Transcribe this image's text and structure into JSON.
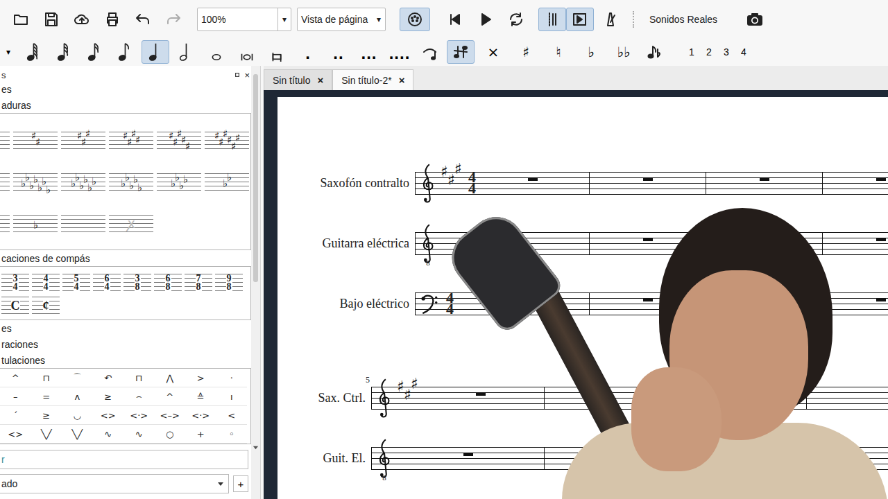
{
  "toolbar": {
    "zoom": "100%",
    "zoom_arrow": "▾",
    "view_mode": "Vista de página",
    "view_arrow": "▾",
    "redo_disabled": true,
    "mixer_on": true,
    "loop_on": false,
    "playback_panels": [
      {
        "selected": true
      },
      {
        "selected": true
      }
    ],
    "metronome_on": false,
    "sound_mode": "Sonidos Reales"
  },
  "note_input": {
    "menu_arrow": "▾",
    "durations": [
      {
        "kind": "flagged",
        "flags": 4,
        "selected": false
      },
      {
        "kind": "flagged",
        "flags": 3,
        "selected": false
      },
      {
        "kind": "flagged",
        "flags": 2,
        "selected": false
      },
      {
        "kind": "flagged",
        "flags": 1,
        "selected": false
      },
      {
        "kind": "quarter",
        "flags": 0,
        "selected": true
      },
      {
        "kind": "half",
        "flags": 0,
        "selected": false
      },
      {
        "kind": "whole",
        "flags": 0,
        "selected": false
      },
      {
        "kind": "breve",
        "flags": 0,
        "selected": false
      },
      {
        "kind": "longa",
        "flags": 0,
        "selected": false
      }
    ],
    "dots": [
      ".",
      "..",
      "...",
      "...."
    ],
    "tie_selected": false,
    "flip_selected": true,
    "accidentals": [
      "×",
      "♯",
      "♮",
      "♭",
      "♭♭"
    ],
    "voices": [
      {
        "label": "1",
        "selected": false
      },
      {
        "label": "2",
        "selected": false
      },
      {
        "label": "3",
        "selected": false
      },
      {
        "label": "4",
        "selected": false
      }
    ]
  },
  "palette": {
    "title": "s",
    "close": "×",
    "items": [
      {
        "kind": "header",
        "label": "es"
      },
      {
        "kind": "header",
        "label": "aduras"
      },
      {
        "kind": "keys",
        "rows": [
          [
            {
              "glyph": "♯",
              "kind": "sharp",
              "count": 2,
              "faded": false
            },
            {
              "glyph": "♯",
              "kind": "sharp",
              "count": 3,
              "faded": false
            },
            {
              "glyph": "♯",
              "kind": "sharp",
              "count": 4,
              "faded": false
            },
            {
              "glyph": "♯",
              "kind": "sharp",
              "count": 5,
              "faded": false
            },
            {
              "glyph": "♯",
              "kind": "sharp",
              "count": 6,
              "faded": false
            }
          ],
          [
            {
              "glyph": "♭",
              "kind": "flat",
              "count": 7,
              "faded": false
            },
            {
              "glyph": "♭",
              "kind": "flat",
              "count": 6,
              "faded": false
            },
            {
              "glyph": "♭",
              "kind": "flat",
              "count": 5,
              "faded": false
            },
            {
              "glyph": "♭",
              "kind": "flat",
              "count": 4,
              "faded": false
            },
            {
              "glyph": "♭",
              "kind": "flat",
              "count": 2,
              "faded": false
            }
          ],
          [
            {
              "glyph": "♭",
              "kind": "flat",
              "count": 1,
              "faded": false
            },
            {
              "glyph": "",
              "kind": "none",
              "count": 0,
              "faded": false
            },
            {
              "glyph": "ꭗ",
              "kind": "cancel",
              "count": 1,
              "faded": true
            }
          ]
        ]
      },
      {
        "kind": "header",
        "label": "caciones de compás"
      },
      {
        "kind": "times",
        "cells": [
          {
            "top": "3",
            "bottom": "4",
            "symbol": ""
          },
          {
            "top": "4",
            "bottom": "4",
            "symbol": ""
          },
          {
            "top": "5",
            "bottom": "4",
            "symbol": ""
          },
          {
            "top": "6",
            "bottom": "4",
            "symbol": ""
          },
          {
            "top": "3",
            "bottom": "8",
            "symbol": ""
          },
          {
            "top": "6",
            "bottom": "8",
            "symbol": ""
          },
          {
            "top": "7",
            "bottom": "8",
            "symbol": ""
          },
          {
            "top": "9",
            "bottom": "8",
            "symbol": ""
          },
          {
            "top": "",
            "bottom": "",
            "symbol": "C"
          },
          {
            "top": "",
            "bottom": "",
            "symbol": "¢"
          }
        ]
      },
      {
        "kind": "header",
        "label": "es"
      },
      {
        "kind": "header",
        "label": "raciones"
      },
      {
        "kind": "header",
        "label": "tulaciones"
      },
      {
        "kind": "symbols",
        "cells": [
          "^",
          "⊓",
          "⌒",
          "↶",
          "⊓",
          "⋀",
          ">",
          "·",
          "–",
          "=",
          "ʌ",
          "≥",
          "⌢",
          "^",
          "≙",
          "ı",
          "ˊ",
          "≥",
          "◡",
          "<>",
          "<·>",
          "<–>",
          "<·>",
          "<",
          "<>",
          "╲╱",
          "╲╱",
          "∿",
          "∿",
          "○",
          "+",
          "◦"
        ]
      }
    ],
    "search": {
      "placeholder": "r"
    },
    "workspace": "ado",
    "add": "+"
  },
  "tabs": [
    {
      "label": "Sin título",
      "close": "×",
      "selected": false
    },
    {
      "label": "Sin título-2*",
      "close": "×",
      "selected": true
    }
  ],
  "systems": [
    {
      "measure_number": "",
      "staves": [
        {
          "name": "Saxofón contralto",
          "clef": "treble",
          "octave": "",
          "key": [
            {
              "glyph": "♯",
              "kind": "sharp"
            },
            {
              "glyph": "♯",
              "kind": "sharp"
            },
            {
              "glyph": "♯",
              "kind": "sharp"
            }
          ],
          "time": {
            "top": "4",
            "bottom": "4"
          }
        },
        {
          "name": "Guitarra eléctrica",
          "clef": "treble",
          "octave": "8",
          "key": [],
          "time": null
        },
        {
          "name": "Bajo eléctrico",
          "clef": "bass",
          "octave": "",
          "key": [],
          "time": {
            "top": "4",
            "bottom": "4"
          }
        }
      ],
      "measures": [
        {
          "rest": true
        },
        {
          "rest": true
        },
        {
          "rest": true
        },
        {
          "rest": true
        }
      ]
    },
    {
      "measure_number": "5",
      "staves": [
        {
          "name": "Sax. Ctrl.",
          "clef": "treble",
          "octave": "",
          "key": [
            {
              "glyph": "♯",
              "kind": "sharp"
            },
            {
              "glyph": "♯",
              "kind": "sharp"
            },
            {
              "glyph": "♯",
              "kind": "sharp"
            }
          ],
          "time": null
        },
        {
          "name": "Guit. El.",
          "clef": "treble",
          "octave": "8",
          "key": [],
          "time": null
        }
      ],
      "measures": [
        {
          "rest": true
        },
        {
          "rest": true
        },
        {
          "rest": true
        }
      ]
    }
  ]
}
